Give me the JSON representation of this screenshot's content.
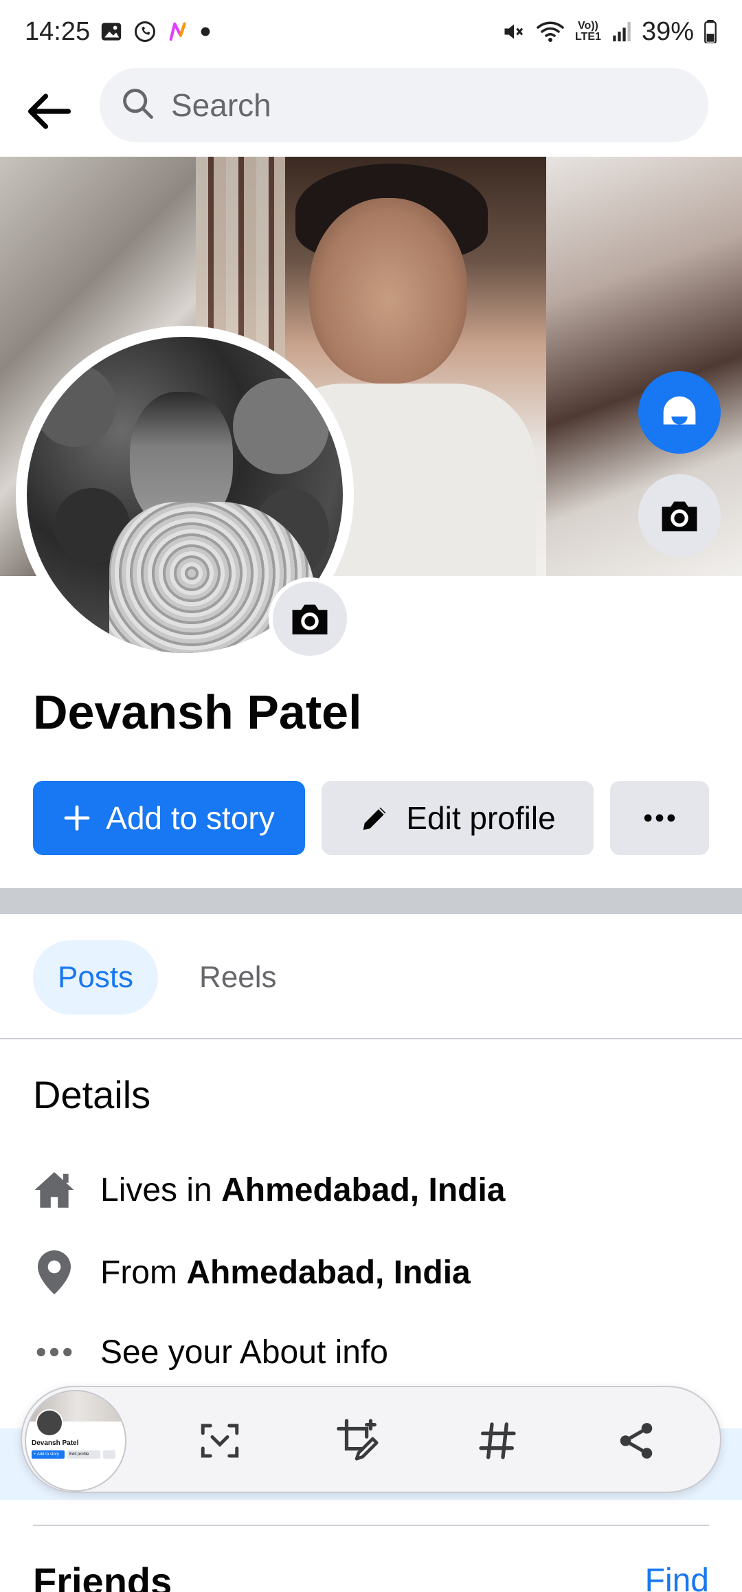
{
  "status_bar": {
    "time": "14:25",
    "battery": "39%",
    "network_label": "Vo)) LTE1"
  },
  "search": {
    "placeholder": "Search"
  },
  "profile": {
    "name": "Devansh Patel"
  },
  "actions": {
    "add_story_label": "Add to story",
    "edit_profile_label": "Edit profile",
    "more_label": "•••"
  },
  "tabs": [
    {
      "label": "Posts",
      "active": true
    },
    {
      "label": "Reels",
      "active": false
    }
  ],
  "details": {
    "title": "Details",
    "lives_prefix": "Lives in ",
    "lives_value": "Ahmedabad, India",
    "from_prefix": "From ",
    "from_value": "Ahmedabad, India",
    "about_label": "See your About info"
  },
  "screenshot_toolbar": {
    "thumb_name": "Devansh Patel",
    "thumb_btn1": "+ Add to story",
    "thumb_btn2": "Edit profile",
    "tools": [
      "scan-icon",
      "crop-edit-icon",
      "hashtag-icon",
      "share-icon"
    ]
  },
  "friends": {
    "title": "Friends",
    "find_label": "Find"
  },
  "colors": {
    "accent": "#1877f2",
    "button_gray": "#e4e6eb",
    "tab_active_bg": "#e7f3ff"
  }
}
